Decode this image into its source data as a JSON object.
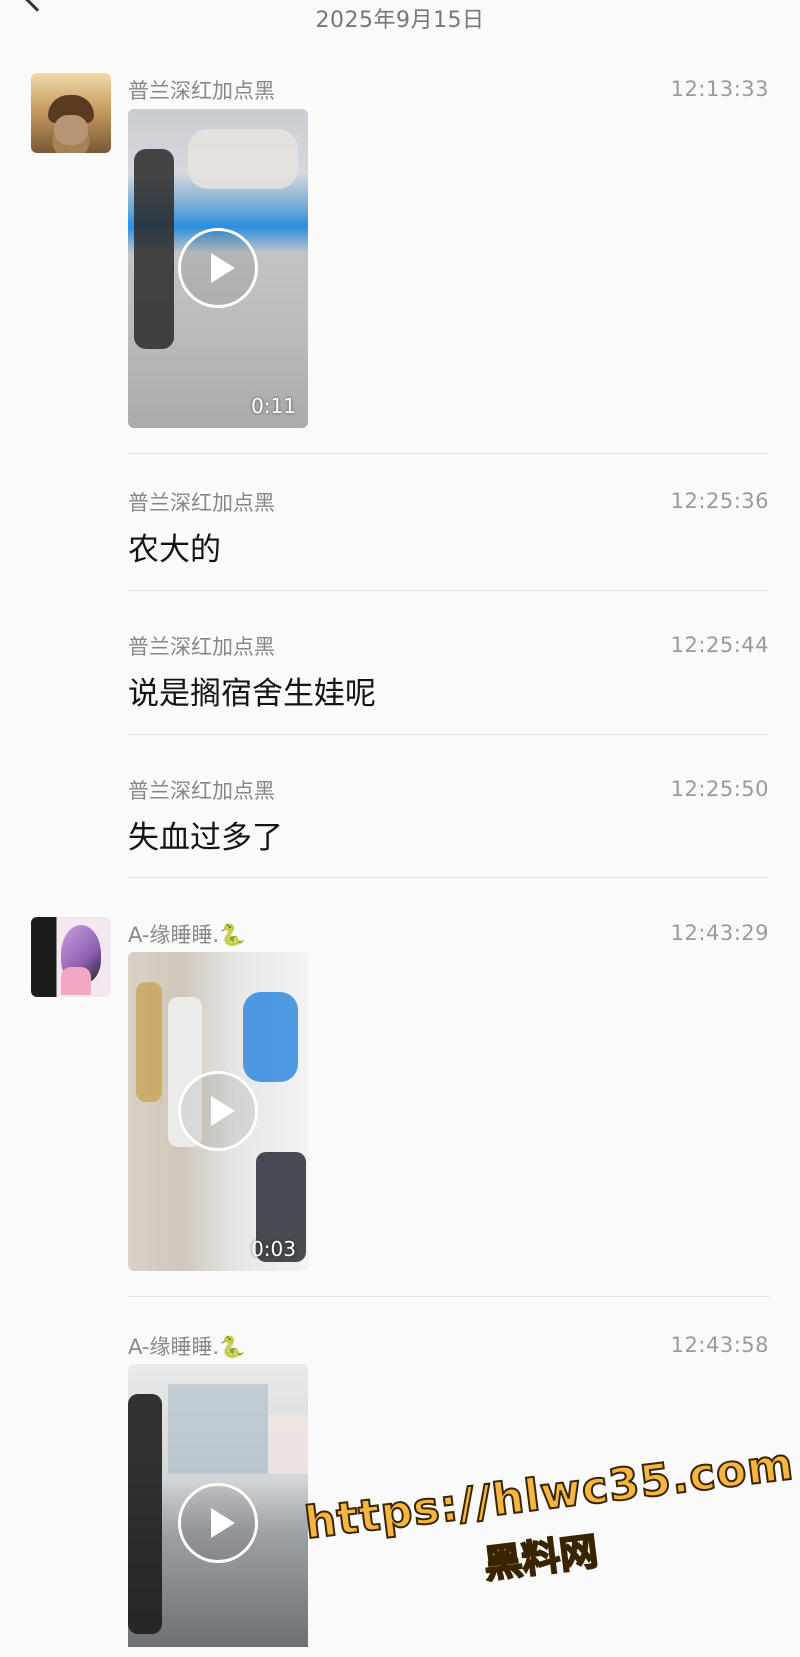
{
  "header": {
    "date": "2025年9月15日"
  },
  "messages": [
    {
      "sender": "普兰深红加点黑",
      "time": "12:13:33",
      "type": "video",
      "duration": "0:11"
    },
    {
      "sender": "普兰深红加点黑",
      "time": "12:25:36",
      "type": "text",
      "text": "农大的"
    },
    {
      "sender": "普兰深红加点黑",
      "time": "12:25:44",
      "type": "text",
      "text": "说是搁宿舍生娃呢"
    },
    {
      "sender": "普兰深红加点黑",
      "time": "12:25:50",
      "type": "text",
      "text": "失血过多了"
    },
    {
      "sender": "A-缘睡睡.🐍",
      "time": "12:43:29",
      "type": "video",
      "duration": "0:03"
    },
    {
      "sender": "A-缘睡睡.🐍",
      "time": "12:43:58",
      "type": "video"
    }
  ],
  "watermark": {
    "url": "https://hlwc35.com",
    "name": "黑料网"
  },
  "icons": {
    "back": "back-arrow-icon",
    "play": "play-icon"
  }
}
